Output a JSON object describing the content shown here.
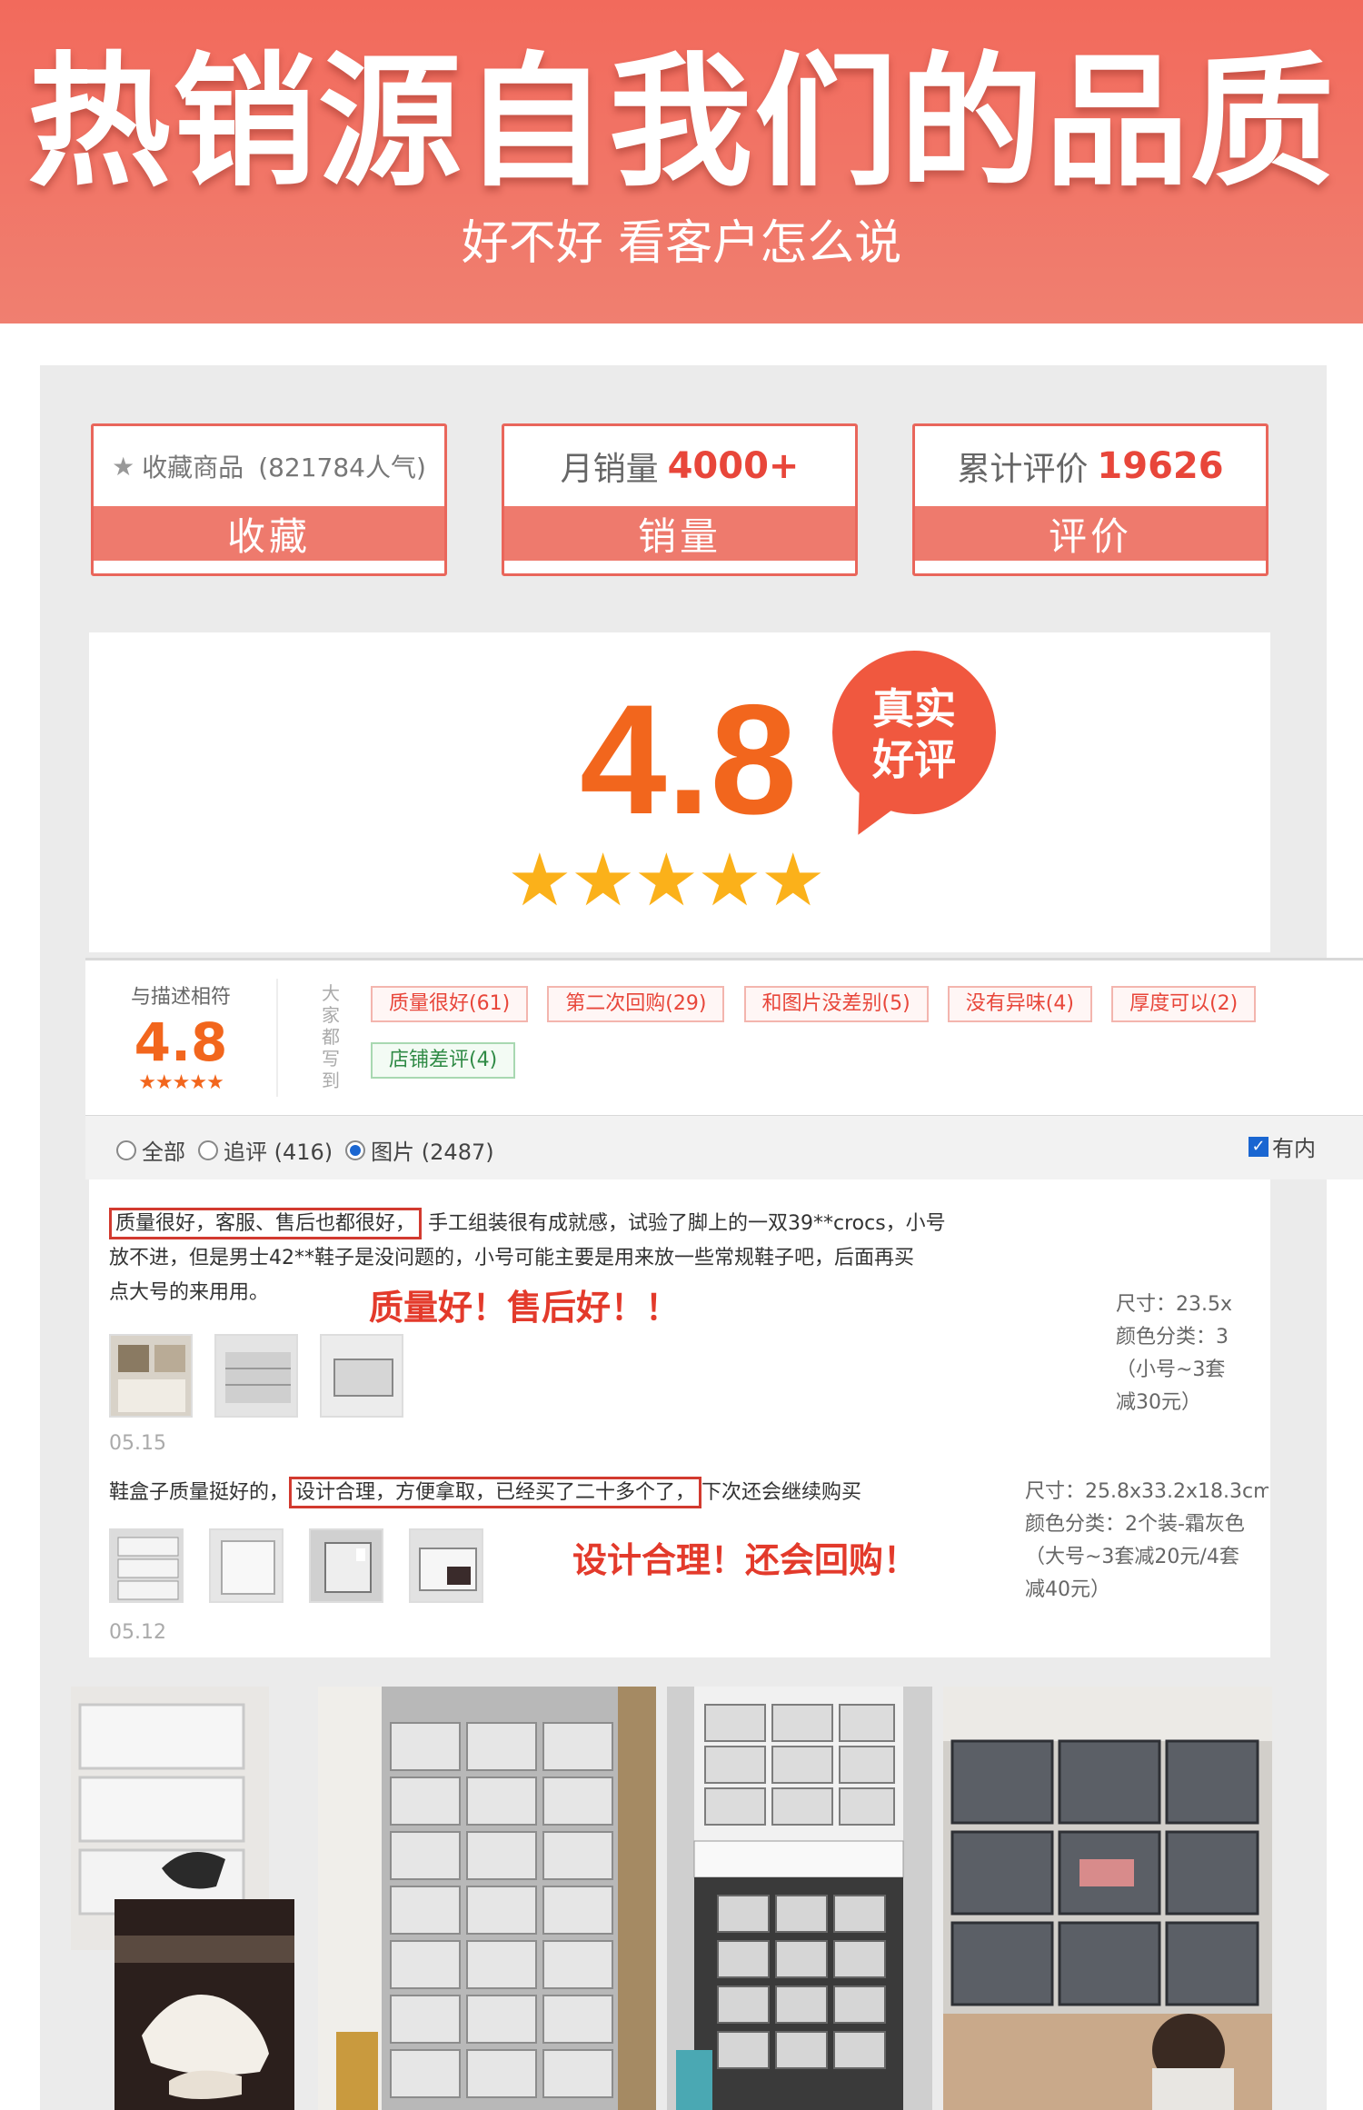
{
  "banner": {
    "title": "热销源自我们的品质",
    "subtitle": "好不好 看客户怎么说"
  },
  "stats": [
    {
      "top_label": "收藏商品",
      "top_value": "(821784人气)",
      "bottom_label": "收藏"
    },
    {
      "top_label": "月销量",
      "top_value": "4000+",
      "bottom_label": "销量"
    },
    {
      "top_label": "累计评价",
      "top_value": "19626",
      "bottom_label": "评价"
    }
  ],
  "rating": {
    "score": "4.8",
    "stars": "★★★★★",
    "bubble_line1": "真实",
    "bubble_line2": "好评"
  },
  "tagbar": {
    "label": "与描述相符",
    "score": "4.8",
    "stars": "★★★★★",
    "vertical_text": "大家都写到",
    "tags": [
      {
        "text": "质量很好(61)",
        "kind": "red"
      },
      {
        "text": "第二次回购(29)",
        "kind": "red"
      },
      {
        "text": "和图片没差别(5)",
        "kind": "red"
      },
      {
        "text": "没有异味(4)",
        "kind": "red"
      },
      {
        "text": "厚度可以(2)",
        "kind": "red"
      },
      {
        "text": "店铺差评(4)",
        "kind": "green"
      }
    ]
  },
  "filter": {
    "all": "全部",
    "followup": "追评 (416)",
    "pictures": "图片 (2487)",
    "selected": "pictures",
    "has_content": "有内"
  },
  "reviews": [
    {
      "highlight": "质量很好，客服、售后也都很好，",
      "text_rest": "手工组装很有成就感，试验了脚上的一双39**crocs，小号",
      "text_line2": "放不进，但是男士42**鞋子是没问题的，小号可能主要是用来放一些常规鞋子吧，后面再买",
      "text_line3": "点大号的来用用。",
      "callout": "质量好！售后好！！",
      "meta_line1": "尺寸：23.5x",
      "meta_line2": "颜色分类：3",
      "meta_line3": "（小号~3套",
      "meta_line4": "减30元）",
      "date": "05.15"
    },
    {
      "text_before": "鞋盒子质量挺好的，",
      "highlight": "设计合理，方便拿取，已经买了二十多个了，",
      "text_after": "下次还会继续购买",
      "callout": "设计合理！还会回购！",
      "meta_line1": "尺寸：25.8x33.2x18.3cm",
      "meta_line2": "颜色分类：2个装-霜灰色",
      "meta_line3": "（大号~3套减20元/4套",
      "meta_line4": "减40元）",
      "date": "05.12"
    }
  ],
  "colors": {
    "brand": "#f26a5c",
    "accent_orange": "#f2661d",
    "star_gold": "#fbb11a",
    "highlight_red": "#d23a2f"
  }
}
